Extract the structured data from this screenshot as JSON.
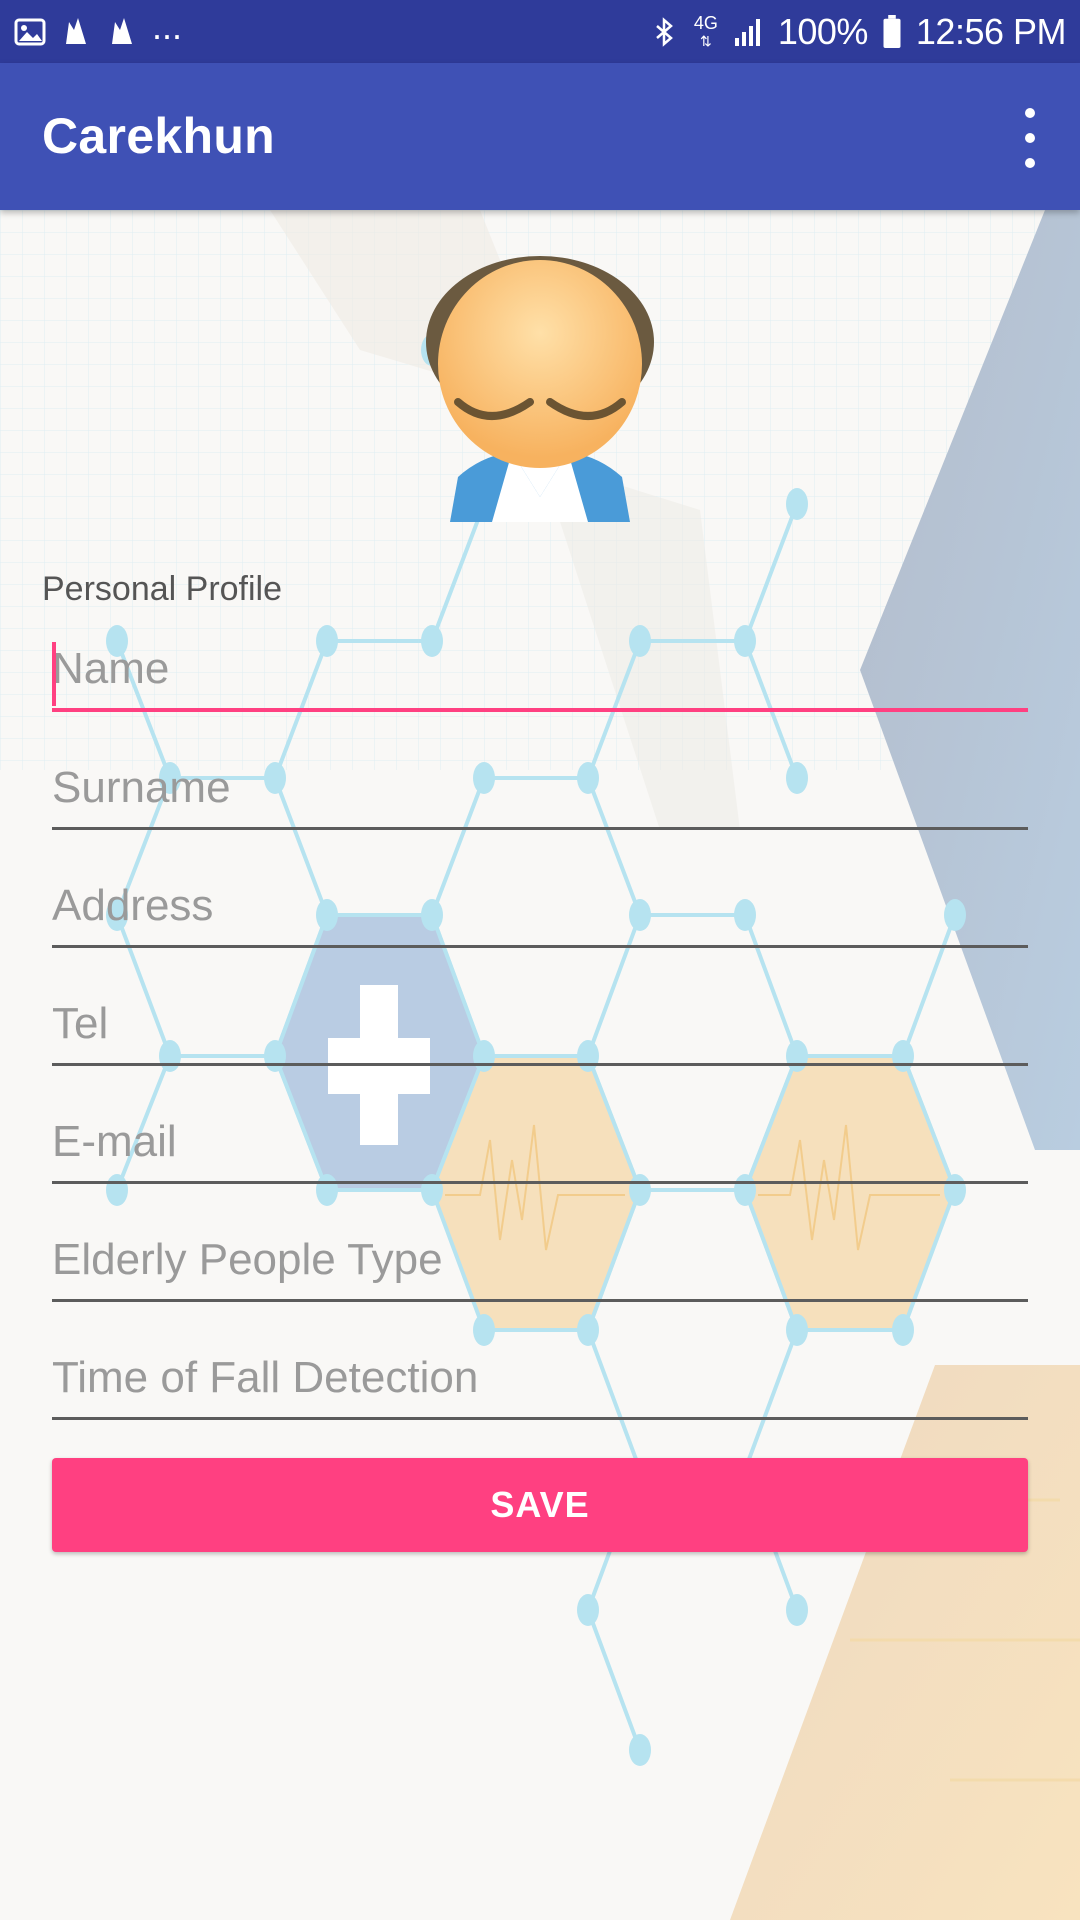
{
  "status_bar": {
    "time": "12:56 PM",
    "battery": "100%",
    "network": "4G",
    "left_icons": [
      "image-icon",
      "flame-icon",
      "flame-icon"
    ],
    "more_indicator": "...",
    "right_icons": [
      "bluetooth-icon",
      "network-4g-icon",
      "signal-icon",
      "battery-icon"
    ]
  },
  "app_bar": {
    "title": "Carekhun",
    "menu_icon": "more-vert-icon"
  },
  "form": {
    "section_label": "Personal Profile",
    "fields": [
      {
        "placeholder": "Name",
        "value": ""
      },
      {
        "placeholder": "Surname",
        "value": ""
      },
      {
        "placeholder": "Address",
        "value": ""
      },
      {
        "placeholder": "Tel",
        "value": ""
      },
      {
        "placeholder": "E-mail",
        "value": ""
      },
      {
        "placeholder": "Elderly People Type",
        "value": ""
      },
      {
        "placeholder": "Time of Fall Detection",
        "value": ""
      }
    ],
    "save_label": "SAVE"
  },
  "colors": {
    "status_bar": "#2f3b9a",
    "app_bar": "#3f51b5",
    "accent": "#ff4081",
    "background": "#f9f8f6"
  }
}
